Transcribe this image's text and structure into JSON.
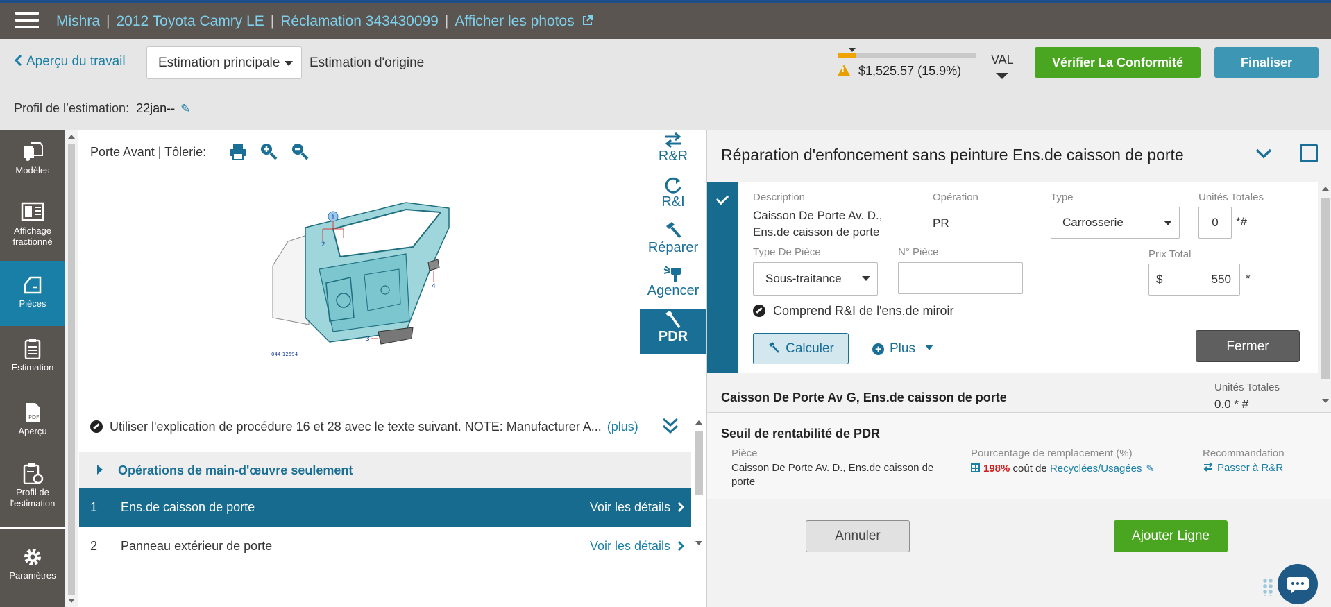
{
  "topbar": {
    "breadcrumbs": [
      "Mishra",
      "2012 Toyota Camry LE",
      "Réclamation 343430099"
    ],
    "photos_link": "Afficher les photos"
  },
  "header": {
    "back_label": "Aperçu du travail",
    "estimate_select": "Estimation principale",
    "estimate_origin": "Estimation d'origine",
    "amount": "$1,525.57 (15.9%)",
    "progress_fraction": 0.13,
    "val_label": "VAL",
    "verify_button": "Vérifier La Conformité",
    "finalize_button": "Finaliser",
    "profile_label": "Profil de l’estimation:",
    "profile_value": "22jan--"
  },
  "leftnav": {
    "items": [
      {
        "label": "Modèles",
        "icon": "models-icon"
      },
      {
        "label": "Affichage fractionné",
        "icon": "split-view-icon"
      },
      {
        "label": "Pièces",
        "icon": "car-door-icon"
      },
      {
        "label": "Estimation",
        "icon": "clipboard-icon"
      },
      {
        "label": "Aperçu",
        "icon": "pdf-icon"
      },
      {
        "label": "Profil de l'estimation",
        "icon": "clipboard-gear-icon"
      },
      {
        "label": "Paramètres",
        "icon": "gear-icon"
      }
    ]
  },
  "diagram": {
    "title": "Porte Avant | Tôlerie:",
    "code": "044-12594",
    "callouts": [
      "1",
      "2",
      "3",
      "4"
    ]
  },
  "operations": [
    {
      "label": "R&R",
      "icon": "replace-icon"
    },
    {
      "label": "R&I",
      "icon": "refresh-icon"
    },
    {
      "label": "Réparer",
      "icon": "hammer-icon"
    },
    {
      "label": "Agencer",
      "icon": "spray-gun-icon"
    },
    {
      "label": "PDR",
      "icon": "pdr-tool-icon"
    }
  ],
  "note": {
    "text": "Utiliser l'explication de procédure 16 et 28 avec le texte suivant. NOTE: Manufacturer A...",
    "more": "(plus)"
  },
  "parts_list": {
    "section_title": "Opérations de main-d'œuvre seulement",
    "rows": [
      {
        "num": "1",
        "name": "Ens.de caisson de porte",
        "detail": "Voir les détails"
      },
      {
        "num": "2",
        "name": "Panneau extérieur de porte",
        "detail": "Voir les détails"
      }
    ]
  },
  "panel": {
    "title": "Réparation d'enfoncement sans peinture Ens.de caisson de porte",
    "description_label": "Description",
    "description_value": "Caisson De Porte Av. D., Ens.de caisson de porte",
    "operation_label": "Opération",
    "operation_value": "PR",
    "type_label": "Type",
    "type_value": "Carrosserie",
    "units_label": "Unités Totales",
    "units_value": "0",
    "units_suffix": "*#",
    "part_type_label": "Type De Pièce",
    "part_type_value": "Sous-traitance",
    "part_num_label": "N° Pièce",
    "part_num_value": "",
    "price_label": "Prix Total",
    "price_currency": "$",
    "price_value": "550",
    "price_suffix": "*",
    "includes_text": "Comprend R&I de l'ens.de miroir",
    "calc_button": "Calculer",
    "plus_label": "Plus",
    "close_button": "Fermer"
  },
  "second_item": {
    "title": "Caisson De Porte Av G, Ens.de caisson de porte",
    "units_label": "Unités Totales",
    "units_value": "0.0 * #"
  },
  "pdr_threshold": {
    "title": "Seuil de rentabilité de PDR",
    "part_label": "Pièce",
    "part_value": "Caisson De Porte Av. D., Ens.de caisson de porte",
    "pct_label": "Pourcentage de remplacement (%)",
    "pct_value": "198%",
    "pct_text": "coût de",
    "pct_link": "Recyclées/Usagées",
    "rec_label": "Recommandation",
    "rec_link": "Passer à R&R"
  },
  "footer": {
    "cancel_button": "Annuler",
    "add_button": "Ajouter Ligne"
  },
  "colors": {
    "accent": "#1a6f96",
    "success": "#4aa520",
    "warning": "#f0a400",
    "danger": "#d22020"
  }
}
